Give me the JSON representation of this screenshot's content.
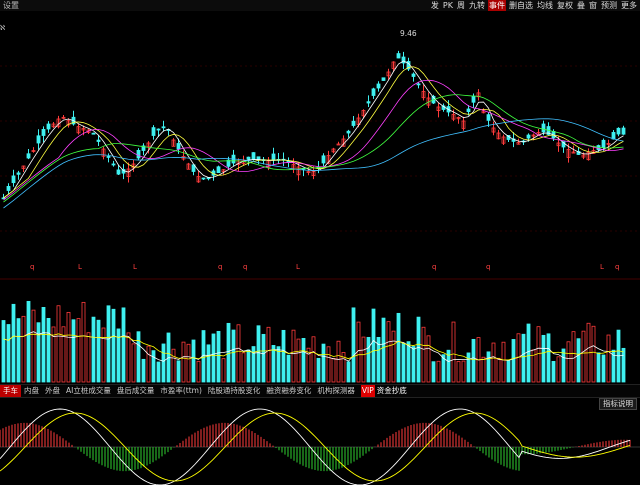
{
  "window": {
    "title": "设置"
  },
  "toolbar": {
    "items": [
      {
        "label": "发",
        "highlight": false
      },
      {
        "label": "PK",
        "highlight": false
      },
      {
        "label": "周",
        "highlight": false
      },
      {
        "label": "九转",
        "highlight": false
      },
      {
        "label": "事件",
        "highlight": true
      },
      {
        "label": "删自选",
        "highlight": false
      },
      {
        "label": "均线",
        "highlight": false
      },
      {
        "label": "复权",
        "highlight": false
      },
      {
        "label": "叠",
        "highlight": false
      },
      {
        "label": "窗",
        "highlight": false
      },
      {
        "label": "预测",
        "highlight": false
      },
      {
        "label": "更多",
        "highlight": false
      }
    ],
    "icons": [
      "zoom-in-icon",
      "zoom-out-icon",
      "settings-icon"
    ]
  },
  "main_chart": {
    "peak_label": "9.46",
    "left_marker": "ℵ",
    "event_markers": [
      {
        "text": "q"
      },
      {
        "text": "L"
      },
      {
        "text": "L"
      },
      {
        "text": "q"
      },
      {
        "text": "q"
      },
      {
        "text": "L"
      },
      {
        "text": "q"
      },
      {
        "text": "q"
      },
      {
        "text": "L"
      },
      {
        "text": "q"
      }
    ],
    "colors": {
      "up": "#ff3b3b",
      "down": "#3ff0f0",
      "ma5": "#ffffff",
      "ma10": "#ffff40",
      "ma20": "#ff40ff",
      "ma30": "#40ff40",
      "ma60": "#40c0ff"
    }
  },
  "tabs": {
    "items": [
      {
        "label": "手车",
        "active": true
      },
      {
        "label": "内盘",
        "active": false
      },
      {
        "label": "外盘",
        "active": false
      },
      {
        "label": "AI立桩成交量",
        "active": false
      },
      {
        "label": "盘后成交量",
        "active": false
      },
      {
        "label": "市盈率(ttm)",
        "active": false
      },
      {
        "label": "陆股通持股变化",
        "active": false
      },
      {
        "label": "融资融券变化",
        "active": false
      },
      {
        "label": "机构探测器",
        "active": false
      },
      {
        "label": "资金抄底",
        "active": false,
        "badge": "VIP"
      }
    ]
  },
  "indicator": {
    "button_label": "指标说明"
  }
}
